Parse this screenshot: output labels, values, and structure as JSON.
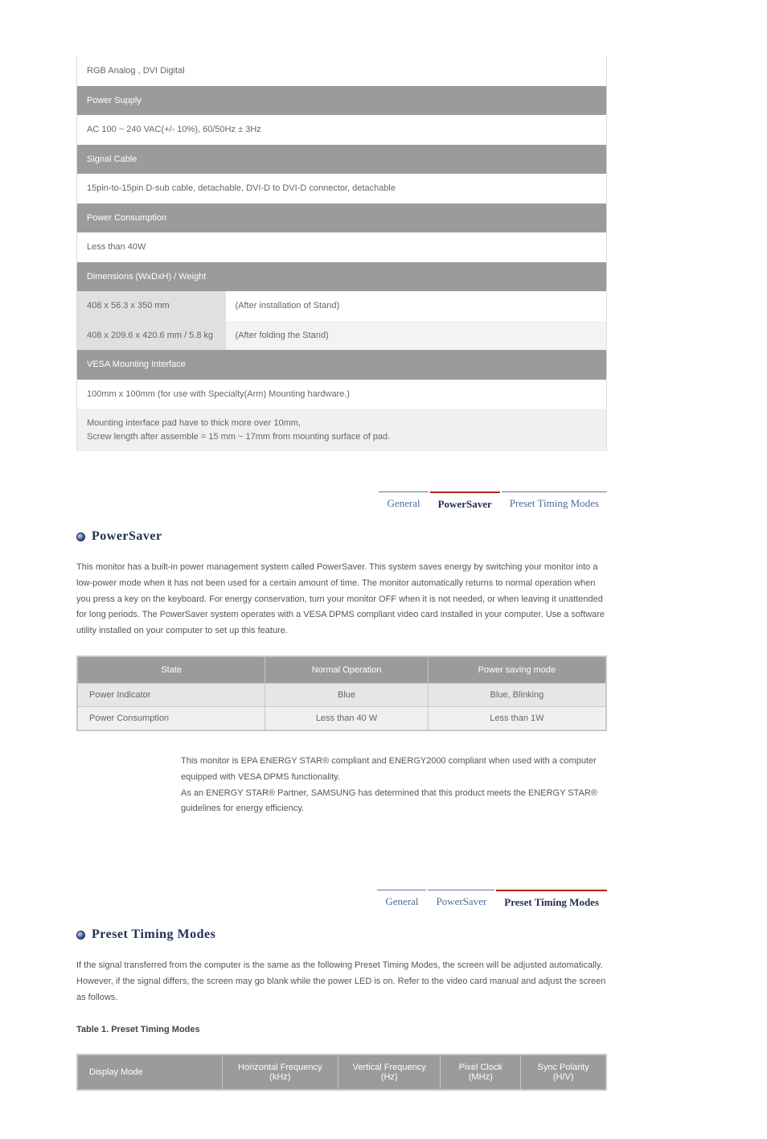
{
  "specs": {
    "sections": [
      {
        "type": "row_white",
        "text": "RGB Analog , DVI Digital"
      },
      {
        "type": "header",
        "text": "Power Supply"
      },
      {
        "type": "row_white",
        "text": "AC 100 ~ 240 VAC(+/- 10%), 60/50Hz ± 3Hz"
      },
      {
        "type": "header",
        "text": "Signal Cable"
      },
      {
        "type": "row_white",
        "text": "15pin-to-15pin D-sub cable, detachable, DVI-D to DVI-D connector, detachable"
      },
      {
        "type": "header",
        "text": "Power Consumption"
      },
      {
        "type": "row_white",
        "text": "Less than 40W"
      },
      {
        "type": "header",
        "text": "Dimensions (WxDxH) / Weight"
      },
      {
        "type": "kv",
        "label": "408 x 56.3 x 350 mm",
        "value": "(After installation of Stand)"
      },
      {
        "type": "kv_light",
        "label": "408 x 209.6 x 420.6 mm / 5.8 kg",
        "value": "(After folding the Stand)"
      },
      {
        "type": "header",
        "text": "VESA Mounting Interface"
      },
      {
        "type": "row_white",
        "text": "100mm x 100mm (for use with Specialty(Arm) Mounting hardware.)"
      },
      {
        "type": "row_light",
        "text": "Mounting interface pad have to thick more over 10mm,\nScrew length after assemble = 15 mm ~ 17mm from mounting surface of pad."
      }
    ]
  },
  "tabs1": {
    "items": [
      "General",
      "PowerSaver",
      "Preset Timing Modes"
    ],
    "active": 1
  },
  "powersaver": {
    "heading": "PowerSaver",
    "para": "This monitor has a built-in power management system called PowerSaver. This system saves energy by switching your monitor into a low-power mode when it has not been used for a certain amount of time. The monitor automatically returns to normal operation when you press a key on the keyboard. For energy conservation, turn your monitor OFF when it is not needed, or when leaving it unattended for long periods. The PowerSaver system operates with a VESA DPMS compliant video card installed in your computer. Use a software utility installed on your computer to set up this feature.",
    "table": {
      "headers": [
        "State",
        "Normal Operation",
        "Power saving mode"
      ],
      "rows": [
        {
          "cells": [
            "Power Indicator",
            "Blue",
            "Blue, Blinking"
          ],
          "class": "t2-r1"
        },
        {
          "cells": [
            "Power Consumption",
            "Less than 40 W",
            "Less than 1W"
          ],
          "class": "t2-r2"
        }
      ]
    },
    "note": "This monitor is EPA ENERGY STAR® compliant and ENERGY2000 compliant when used with a computer equipped with VESA DPMS functionality.\nAs an ENERGY STAR® Partner, SAMSUNG has determined that this product meets the ENERGY STAR® guidelines for energy efficiency."
  },
  "tabs2": {
    "items": [
      "General",
      "PowerSaver",
      "Preset Timing Modes"
    ],
    "active": 2
  },
  "preset": {
    "heading": "Preset Timing Modes",
    "para": "If the signal transferred from the computer is the same as the following Preset Timing Modes, the screen will be adjusted automatically. However, if the signal differs, the screen may go blank while the power LED is on. Refer to the video card manual and adjust the screen as follows.",
    "tableTitle": "Table 1. Preset Timing Modes",
    "headers": [
      "Display Mode",
      "Horizontal Frequency (kHz)",
      "Vertical Frequency (Hz)",
      "Pixel Clock (MHz)",
      "Sync Polarity (H/V)"
    ]
  }
}
